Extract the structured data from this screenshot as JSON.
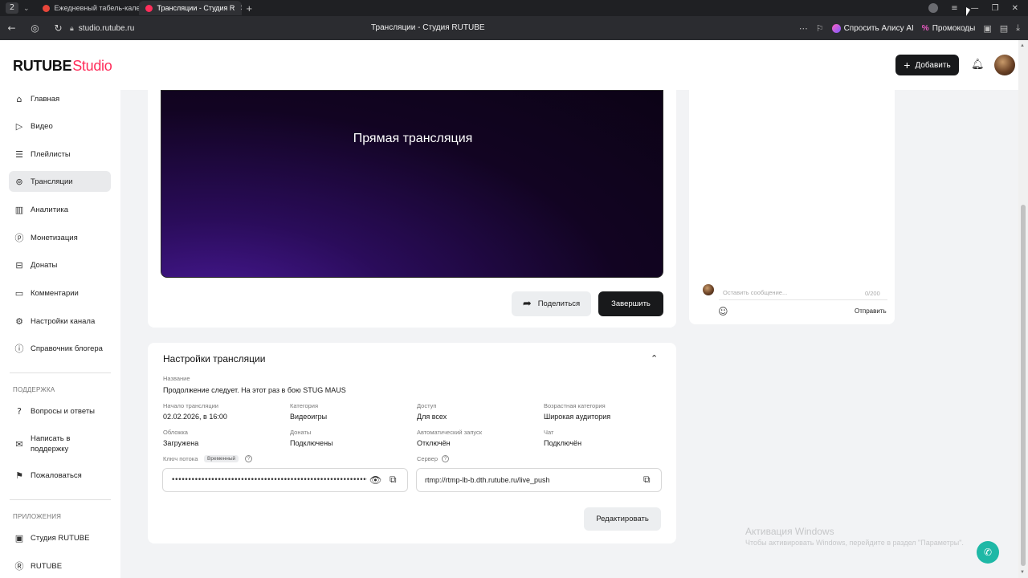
{
  "browser": {
    "tab_count": "2",
    "tabs": [
      {
        "label": "Ежедневный табель-кале",
        "fav_color": "#e8463a"
      },
      {
        "label": "Трансляции - Студия R",
        "fav_color": "#ff2e5b"
      }
    ],
    "url": "studio.rutube.ru",
    "page_title": "Трансляции - Студия RUTUBE",
    "alice_label": "Спросить Алису AI",
    "promo_label": "Промокоды"
  },
  "header": {
    "logo_main": "RUTUBE",
    "logo_studio": "Studio",
    "add_label": "Добавить"
  },
  "sidebar": {
    "items": [
      {
        "label": "Главная",
        "icon": "home-icon"
      },
      {
        "label": "Видео",
        "icon": "video-icon"
      },
      {
        "label": "Плейлисты",
        "icon": "playlist-icon"
      },
      {
        "label": "Трансляции",
        "icon": "broadcast-icon"
      },
      {
        "label": "Аналитика",
        "icon": "analytics-icon"
      },
      {
        "label": "Монетизация",
        "icon": "money-icon"
      },
      {
        "label": "Донаты",
        "icon": "donate-icon"
      },
      {
        "label": "Комментарии",
        "icon": "comments-icon"
      },
      {
        "label": "Настройки канала",
        "icon": "gear-icon"
      },
      {
        "label": "Справочник блогера",
        "icon": "help-icon"
      }
    ],
    "support_label": "ПОДДЕРЖКА",
    "support_items": [
      {
        "label": "Вопросы и ответы"
      },
      {
        "label_line1": "Написать в",
        "label_line2": "поддержку"
      },
      {
        "label": "Пожаловаться"
      }
    ],
    "apps_label": "ПРИЛОЖЕНИЯ",
    "apps_items": [
      {
        "label": "Студия RUTUBE"
      },
      {
        "label": "RUTUBE"
      }
    ]
  },
  "player": {
    "title": "Прямая трансляция",
    "share_label": "Поделиться",
    "end_label": "Завершить"
  },
  "chat": {
    "placeholder": "Оставить сообщение...",
    "counter": "0/200",
    "send_label": "Отправить"
  },
  "settings": {
    "title": "Настройки трансляции",
    "name_label": "Название",
    "name_value": "Продолжение следует. На этот раз в бою STUG MAUS",
    "fields": [
      {
        "label": "Начало трансляции",
        "value": "02.02.2026, в 16:00"
      },
      {
        "label": "Категория",
        "value": "Видеоигры"
      },
      {
        "label": "Доступ",
        "value": "Для всех"
      },
      {
        "label": "Возрастная категория",
        "value": "Широкая аудитория"
      },
      {
        "label": "Обложка",
        "value": "Загружена"
      },
      {
        "label": "Донаты",
        "value": "Подключены"
      },
      {
        "label": "Автоматический запуск",
        "value": "Отключён"
      },
      {
        "label": "Чат",
        "value": "Подключён"
      }
    ],
    "key_label": "Ключ потока",
    "key_badge": "Временный",
    "key_value": "••••••••••••••••••••••••••••••••••••••••••••••••••••••••••••••••••••",
    "server_label": "Сервер",
    "server_value": "rtmp://rtmp-lb-b.dth.rutube.ru/live_push",
    "edit_label": "Редактировать"
  },
  "watermark": {
    "line1": "Активация Windows",
    "line2": "Чтобы активировать Windows, перейдите в раздел \"Параметры\"."
  }
}
